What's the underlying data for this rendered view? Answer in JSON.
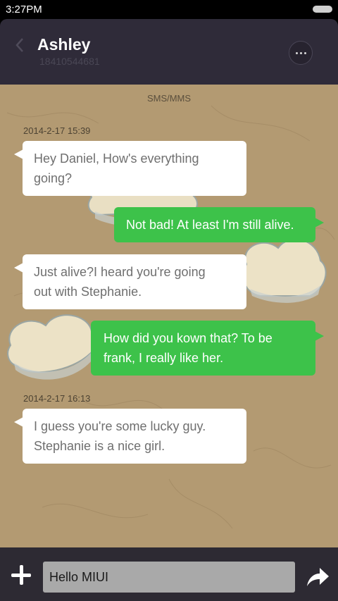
{
  "status_bar": {
    "time": "3:27PM"
  },
  "header": {
    "contact_name": "Ashley",
    "contact_number": "18410544681"
  },
  "conversation": {
    "channel_label": "SMS/MMS",
    "timestamps": [
      "2014-2-17 15:39",
      "2014-2-17 16:13"
    ],
    "messages": [
      {
        "direction": "incoming",
        "line1": "Hey Daniel, How's everything",
        "line2": "going?"
      },
      {
        "direction": "outgoing",
        "line1": "Not bad! At least I'm still alive."
      },
      {
        "direction": "incoming",
        "line1": "Just  alive?I heard you're going",
        "line2": "out with Stephanie."
      },
      {
        "direction": "outgoing",
        "line1": "How did you kown that? To be",
        "line2": "frank, I really like her."
      },
      {
        "direction": "incoming",
        "line1": "I guess you're some lucky guy.",
        "line2": "Stephanie is a nice girl."
      }
    ]
  },
  "composer": {
    "input_value": "Hello MIUI"
  },
  "icons": {
    "back": "chevron-left-icon",
    "more": "more-dots-icon",
    "add": "plus-icon",
    "send": "send-arrow-icon"
  },
  "colors": {
    "header_bg": "#2f2b39",
    "chat_bg": "#b39a72",
    "incoming_bubble": "#ffffff",
    "outgoing_bubble": "#3dc24a",
    "input_bar_bg": "#2d2a33"
  }
}
